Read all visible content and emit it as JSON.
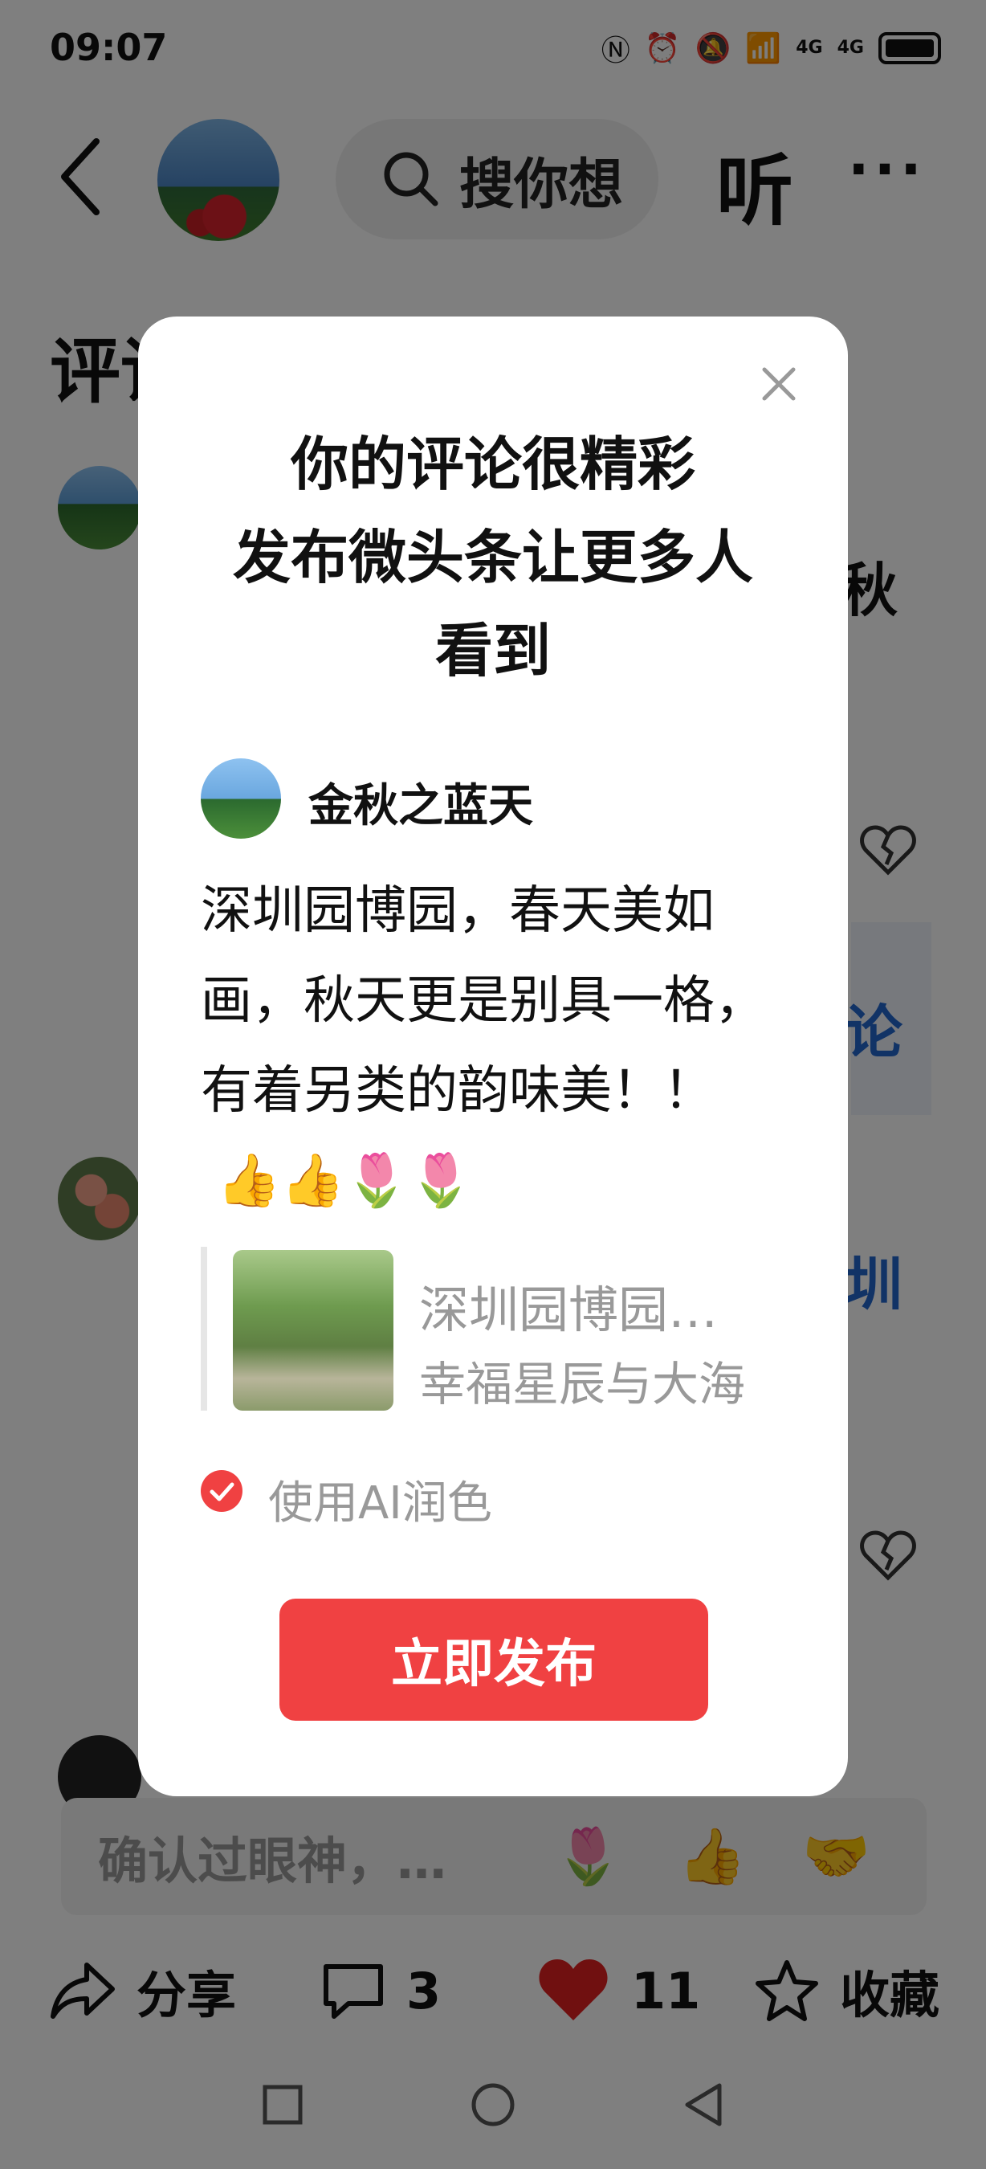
{
  "status_bar": {
    "time": "09:07",
    "net1": "4G",
    "net2": "4G"
  },
  "header": {
    "search_placeholder": "搜你想",
    "listen_label": "听",
    "more_label": "···"
  },
  "background": {
    "section_title": "评论",
    "snippet_1": "秋",
    "link_1": "论",
    "link_2": "圳",
    "composer_placeholder": "确认过眼神，…",
    "composer_emojis": [
      "🌷",
      "👍",
      "🤝"
    ]
  },
  "actions": {
    "share_label": "分享",
    "comment_count": "3",
    "like_count": "11",
    "favorite_label": "收藏"
  },
  "dialog": {
    "title_line1": "你的评论很精彩",
    "title_line2": "发布微头条让更多人",
    "title_line3": "看到",
    "author_name": "金秋之蓝天",
    "comment_text": "深圳园博园，春天美如画，秋天更是别具一格，有着另类的韵味美！！",
    "comment_emojis": "👍👍🌷🌷",
    "quote_title": "深圳园博园…",
    "quote_author": "幸福星辰与大海",
    "ai_polish_label": "使用AI润色",
    "ai_polish_checked": true,
    "publish_label": "立即发布"
  },
  "colors": {
    "accent_red": "#f04142",
    "overlay": "rgba(0,0,0,0.5)",
    "muted_text": "#999999",
    "link_blue": "#2266cc"
  }
}
